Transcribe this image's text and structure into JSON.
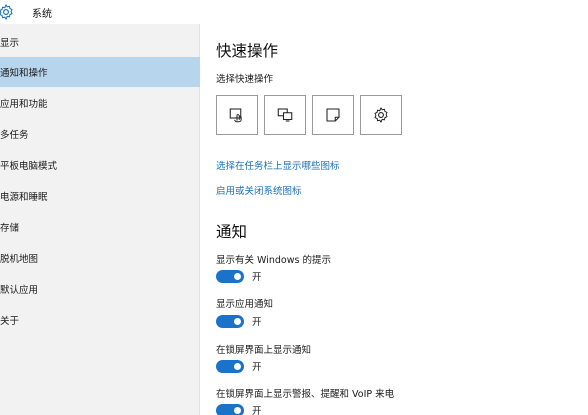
{
  "window": {
    "title": "系统"
  },
  "sidebar": {
    "items": [
      {
        "label": "显示",
        "active": false
      },
      {
        "label": "通知和操作",
        "active": true
      },
      {
        "label": "应用和功能",
        "active": false
      },
      {
        "label": "多任务",
        "active": false
      },
      {
        "label": "平板电脑模式",
        "active": false
      },
      {
        "label": "电源和睡眠",
        "active": false
      },
      {
        "label": "存储",
        "active": false
      },
      {
        "label": "脱机地图",
        "active": false
      },
      {
        "label": "默认应用",
        "active": false
      },
      {
        "label": "关于",
        "active": false
      }
    ]
  },
  "quick_actions": {
    "heading": "快速操作",
    "subtitle": "选择快速操作",
    "buttons": [
      {
        "icon": "tablet-mode-icon"
      },
      {
        "icon": "project-icon"
      },
      {
        "icon": "note-icon"
      },
      {
        "icon": "settings-gear-icon"
      }
    ],
    "link_taskbar_icons": "选择在任务栏上显示哪些图标",
    "link_system_icons": "启用或关闭系统图标"
  },
  "notifications": {
    "heading": "通知",
    "settings": [
      {
        "label": "显示有关 Windows 的提示",
        "state": "开"
      },
      {
        "label": "显示应用通知",
        "state": "开"
      },
      {
        "label": "在锁屏界面上显示通知",
        "state": "开"
      },
      {
        "label": "在锁屏界面上显示警报、提醒和 VoIP 来电",
        "state": "开"
      }
    ]
  },
  "colors": {
    "accent": "#1a73c8",
    "link": "#1c6fb8",
    "sidebar_active": "#b8d5ee"
  }
}
